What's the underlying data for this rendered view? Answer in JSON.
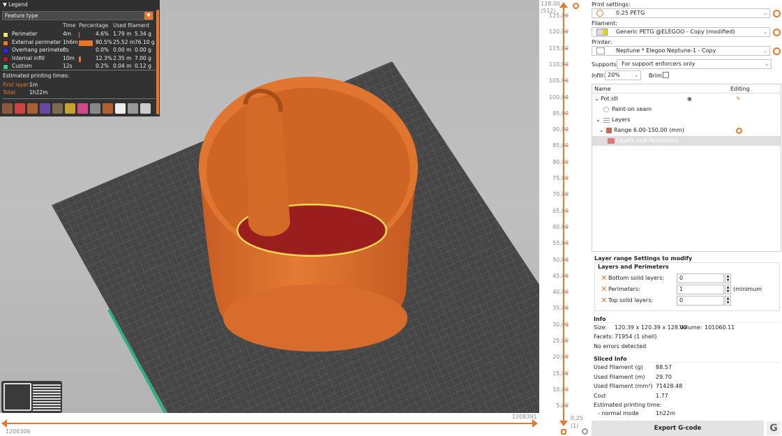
{
  "legend": {
    "title": "Legend",
    "feature_select": "Feature type",
    "columns": {
      "time": "Time",
      "percentage": "Percentage",
      "filament": "Used filament"
    },
    "rows": [
      {
        "name": "Perimeter",
        "time": "4m",
        "pct": "4.6%",
        "len": "1.79 m",
        "weight": "5.34 g",
        "color": "#f5e45a",
        "fraction": 0.046
      },
      {
        "name": "External perimeter",
        "time": "1h6m",
        "pct": "80.5%",
        "len": "25.52 m",
        "weight": "76.10 g",
        "color": "#e8772b",
        "fraction": 0.805
      },
      {
        "name": "Overhang perimeter",
        "time": "0s",
        "pct": "0.0%",
        "len": "0.00 m",
        "weight": "0.00 g",
        "color": "#2a2ae8",
        "fraction": 0.0
      },
      {
        "name": "Internal infill",
        "time": "10m",
        "pct": "12.3%",
        "len": "2.35 m",
        "weight": "7.00 g",
        "color": "#b02020",
        "fraction": 0.123
      },
      {
        "name": "Custom",
        "time": "12s",
        "pct": "0.2%",
        "len": "0.04 m",
        "weight": "0.12 g",
        "color": "#3fce8a",
        "fraction": 0.002
      }
    ],
    "estimated_label": "Estimated printing times:",
    "first_layer_label": "First layer:",
    "first_layer_value": "1m",
    "total_label": "Total:",
    "total_value": "1h22m"
  },
  "hslider": {
    "left_label": "1206306",
    "right_label": "1208391"
  },
  "vslider": {
    "top_label": "128.00",
    "top_sub": "(512)",
    "bottom_label": "0.25",
    "bottom_sub": "(1)",
    "ticks": [
      "125.00",
      "120.00",
      "115.00",
      "110.00",
      "105.00",
      "100.00",
      "95.00",
      "90.00",
      "85.00",
      "80.00",
      "75.00",
      "70.00",
      "65.00",
      "60.00",
      "55.00",
      "50.00",
      "45.00",
      "40.00",
      "35.00",
      "30.00",
      "25.00",
      "20.00",
      "15.00",
      "10.00",
      "5.00"
    ]
  },
  "panel": {
    "print_settings_label": "Print settings:",
    "print_settings_value": "0.25 PETG",
    "filament_label": "Filament:",
    "filament_value": "Generic PETG @ELEGOO - Copy (modified)",
    "printer_label": "Printer:",
    "printer_value": "Neptune * Elegoo Neptune-1 - Copy",
    "supports_label": "Supports:",
    "supports_value": "For support enforcers only",
    "infill_label": "Infill:",
    "infill_value": "20%",
    "brim_label": "Brim:",
    "tree_header_name": "Name",
    "tree_header_editing": "Editing",
    "tree": {
      "object": "Pot.stl",
      "seam": "Paint-on seam",
      "layers": "Layers",
      "range": "Range 6.00-150.00 (mm)",
      "layer_item": "Layers and Perimeters"
    },
    "lrs_title": "Layer range Settings to modify",
    "lrs_group": "Layers and Perimeters",
    "fields": [
      {
        "label": "Bottom solid layers:",
        "value": "0",
        "suffix": ""
      },
      {
        "label": "Perimeters:",
        "value": "1",
        "suffix": "(minimum"
      },
      {
        "label": "Top solid layers:",
        "value": "0",
        "suffix": ""
      }
    ],
    "info_title": "Info",
    "size_label": "Size:",
    "size_value": "120.39 x 120.39 x 128.00",
    "volume_label": "Volume:",
    "volume_value": "101060.11",
    "facets_label": "Facets:",
    "facets_value": "71954 (1 shell)",
    "errors": "No errors detected",
    "sliced_title": "Sliced Info",
    "sliced": [
      {
        "label": "Used Filament (g)",
        "value": "88.57"
      },
      {
        "label": "Used Filament (m)",
        "value": "29.70"
      },
      {
        "label": "Used Filament (mm³)",
        "value": "71428.48"
      },
      {
        "label": "Cost",
        "value": "1.77"
      }
    ],
    "est_label": "Estimated printing time:",
    "mode_label": "- normal mode",
    "mode_value": "1h22m",
    "export_label": "Export G-code",
    "g_logo": "G"
  },
  "colors": {
    "accent": "#e8772b",
    "bed": "#464646",
    "grid": "#6a6a6a",
    "part": "#d96a2a"
  }
}
